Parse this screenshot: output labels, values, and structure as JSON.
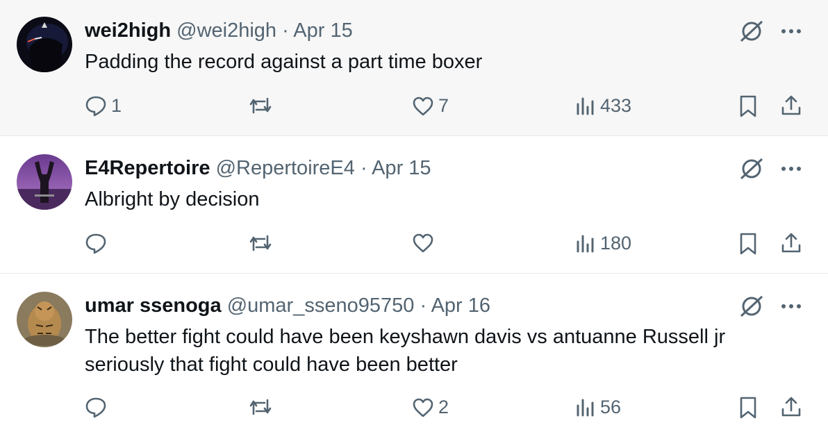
{
  "tweets": [
    {
      "name": "wei2high",
      "handle": "@wei2high",
      "separator": "·",
      "date": "Apr 15",
      "text": "Padding the record against a part time boxer",
      "avatar_icon": "hooded-figure-avatar",
      "replies": "1",
      "reposts": "",
      "likes": "7",
      "views": "433"
    },
    {
      "name": "E4Repertoire",
      "handle": "@RepertoireE4",
      "separator": "·",
      "date": "Apr 15",
      "text": "Albright by decision",
      "avatar_icon": "purple-sky-figure-avatar",
      "replies": "",
      "reposts": "",
      "likes": "",
      "views": "180"
    },
    {
      "name": "umar ssenoga",
      "handle": "@umar_sseno95750",
      "separator": "·",
      "date": "Apr 16",
      "text": "The better fight could have been keyshawn davis vs antuanne Russell jr seriously that fight could have been better",
      "avatar_icon": "tiger-avatar",
      "replies": "",
      "reposts": "",
      "likes": "2",
      "views": "56"
    }
  ],
  "icons": {
    "grok": "grok-icon",
    "more": "more-dots-icon",
    "reply": "reply-bubble-icon",
    "repost": "repost-icon",
    "like": "heart-icon",
    "views": "views-chart-icon",
    "bookmark": "bookmark-icon",
    "share": "share-icon"
  },
  "colors": {
    "text": "#0f1419",
    "secondary": "#536471",
    "hover_background": "#f7f7f7",
    "divider": "#e6ecf0"
  }
}
